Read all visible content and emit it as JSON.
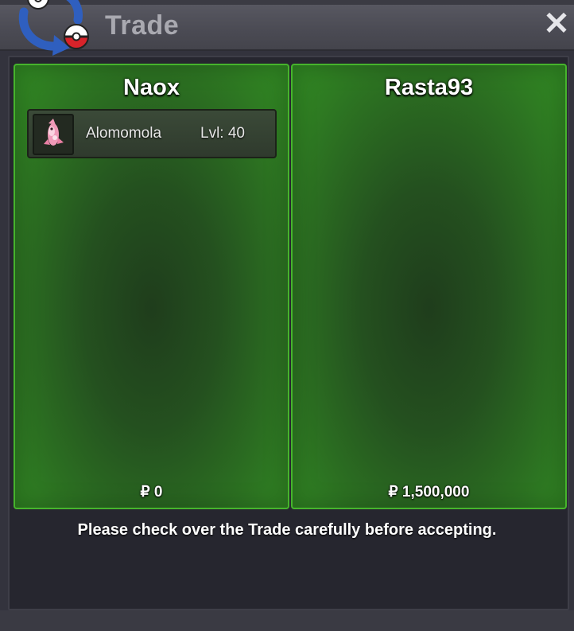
{
  "window": {
    "title": "Trade",
    "close_label": "✕"
  },
  "traders": [
    {
      "name": "Naox",
      "money": "₽ 0",
      "items": [
        {
          "pokemon": "Alomomola",
          "level": "Lvl: 40",
          "icon": "alomomola-sprite-icon"
        }
      ]
    },
    {
      "name": "Rasta93",
      "money": "₽ 1,500,000",
      "items": []
    }
  ],
  "notice": "Please check over the Trade carefully before accepting.",
  "colors": {
    "panel_border": "#46b42c",
    "panel_fill": "#2e7a22",
    "window_bg": "#26262f",
    "title_text": "#a9a9b0"
  }
}
